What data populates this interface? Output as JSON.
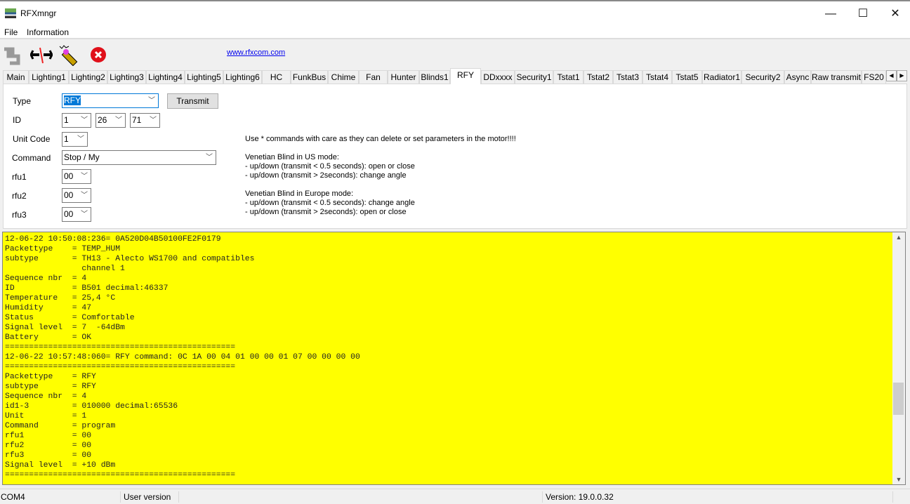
{
  "window": {
    "title": "RFXmngr",
    "minimize": "—",
    "maximize": "☐",
    "close": "✕"
  },
  "menu": [
    "File",
    "Information"
  ],
  "toolbar": {
    "icons": [
      "connect-icon",
      "disconnect-icon",
      "receiver-icon",
      "stop-icon"
    ],
    "link": "www.rfxcom.com"
  },
  "tabs": [
    {
      "label": "Main",
      "l": 4,
      "w": 37
    },
    {
      "label": "Lighting1",
      "l": 41,
      "w": 57
    },
    {
      "label": "Lighting2",
      "l": 98,
      "w": 55
    },
    {
      "label": "Lighting3",
      "l": 153,
      "w": 55
    },
    {
      "label": "Lighting4",
      "l": 208,
      "w": 55
    },
    {
      "label": "Lighting5",
      "l": 263,
      "w": 55
    },
    {
      "label": "Lighting6",
      "l": 318,
      "w": 55
    },
    {
      "label": "HC",
      "l": 373,
      "w": 41
    },
    {
      "label": "FunkBus",
      "l": 414,
      "w": 53
    },
    {
      "label": "Chime",
      "l": 467,
      "w": 44
    },
    {
      "label": "Fan",
      "l": 511,
      "w": 41
    },
    {
      "label": "Hunter",
      "l": 552,
      "w": 45
    },
    {
      "label": "Blinds1",
      "l": 597,
      "w": 44
    },
    {
      "label": "RFY",
      "l": 641,
      "w": 44
    },
    {
      "label": "DDxxxx",
      "l": 685,
      "w": 48
    },
    {
      "label": "Security1",
      "l": 733,
      "w": 55
    },
    {
      "label": "Tstat1",
      "l": 788,
      "w": 43
    },
    {
      "label": "Tstat2",
      "l": 831,
      "w": 42
    },
    {
      "label": "Tstat3",
      "l": 873,
      "w": 42
    },
    {
      "label": "Tstat4",
      "l": 915,
      "w": 42
    },
    {
      "label": "Tstat5",
      "l": 957,
      "w": 43
    },
    {
      "label": "Radiator1",
      "l": 1000,
      "w": 56
    },
    {
      "label": "Security2",
      "l": 1056,
      "w": 61
    },
    {
      "label": "Async",
      "l": 1117,
      "w": 38
    },
    {
      "label": "Raw transmit",
      "l": 1155,
      "w": 72
    },
    {
      "label": "FS20",
      "l": 1227,
      "w": 35
    }
  ],
  "selected_tab": "RFY",
  "form": {
    "type_label": "Type",
    "type_value": "RFY",
    "transmit": "Transmit",
    "id_label": "ID",
    "id1": "1",
    "id2": "26",
    "id3": "71",
    "unit_label": "Unit Code",
    "unit_value": "1",
    "command_label": "Command",
    "command_value": "Stop / My",
    "rfu1_label": "rfu1",
    "rfu1_value": "00",
    "rfu2_label": "rfu2",
    "rfu2_value": "00",
    "rfu3_label": "rfu3",
    "rfu3_value": "00"
  },
  "notes": "Use * commands with care as they can delete or set parameters in the motor!!!!\n\nVenetian Blind in US mode:\n- up/down (transmit < 0.5 seconds): open or close\n- up/down (transmit > 2seconds): change angle\n\nVenetian Blind in Europe mode:\n- up/down (transmit < 0.5 seconds): change angle\n- up/down (transmit > 2seconds): open or close",
  "log": "12-06-22 10:50:08:236= 0A520D04B50100FE2F0179\nPackettype    = TEMP_HUM\nsubtype       = TH13 - Alecto WS1700 and compatibles\n                channel 1\nSequence nbr  = 4\nID            = B501 decimal:46337\nTemperature   = 25,4 °C\nHumidity      = 47\nStatus        = Comfortable\nSignal level  = 7  -64dBm\nBattery       = OK\n================================================\n12-06-22 10:57:48:060= RFY command: 0C 1A 00 04 01 00 00 01 07 00 00 00 00\n================================================\nPackettype    = RFY\nsubtype       = RFY\nSequence nbr  = 4\nid1-3         = 010000 decimal:65536\nUnit          = 1\nCommand       = program\nrfu1          = 00\nrfu2          = 00\nrfu3          = 00\nSignal level  = +10 dBm\n================================================",
  "log_scroll_position": 0.7,
  "status": {
    "port": "COM4",
    "edition": "User version",
    "version": "Version: 19.0.0.32"
  }
}
